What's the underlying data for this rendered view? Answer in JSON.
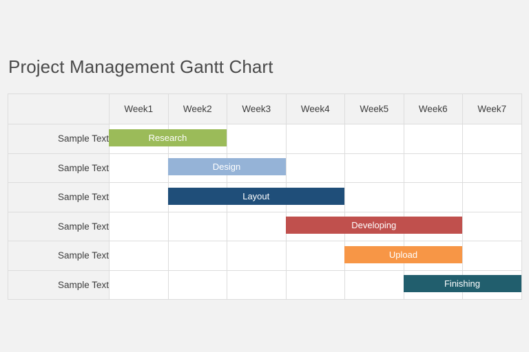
{
  "page": {
    "title": "Project Management Gantt Chart",
    "background_color": "#f2f2f2"
  },
  "table": {
    "corner_label": "",
    "column_headers": [
      "Week1",
      "Week2",
      "Week3",
      "Week4",
      "Week5",
      "Week6",
      "Week7"
    ],
    "row_labels": [
      "Sample Text",
      "Sample Text",
      "Sample Text",
      "Sample Text",
      "Sample Text",
      "Sample Text"
    ],
    "header_background": "#f2f2f2",
    "cell_background": "#ffffff",
    "border_color": "#dcdcdc"
  },
  "chart_data": {
    "type": "bar",
    "title": "Project Management Gantt Chart",
    "xlabel": "",
    "ylabel": "",
    "categories": [
      "Week1",
      "Week2",
      "Week3",
      "Week4",
      "Week5",
      "Week6",
      "Week7"
    ],
    "x": [
      1,
      2,
      3,
      4,
      5,
      6,
      7
    ],
    "xlim": [
      1,
      8
    ],
    "grid": true,
    "legend": "none",
    "orientation": "horizontal",
    "row_labels": [
      "Sample Text",
      "Sample Text",
      "Sample Text",
      "Sample Text",
      "Sample Text",
      "Sample Text"
    ],
    "tasks": [
      {
        "name": "Research",
        "row": 1,
        "row_label": "Sample Text",
        "start_week": 1.0,
        "end_week": 3.0,
        "duration_weeks": 2.0,
        "color": "#9bbb59",
        "label_color": "#ffffff"
      },
      {
        "name": "Design",
        "row": 2,
        "row_label": "Sample Text",
        "start_week": 2.0,
        "end_week": 4.0,
        "duration_weeks": 2.0,
        "color": "#95b3d7",
        "label_color": "#ffffff"
      },
      {
        "name": "Layout",
        "row": 3,
        "row_label": "Sample Text",
        "start_week": 2.0,
        "end_week": 5.0,
        "duration_weeks": 3.0,
        "color": "#1f4e79",
        "label_color": "#ffffff"
      },
      {
        "name": "Developing",
        "row": 4,
        "row_label": "Sample Text",
        "start_week": 4.0,
        "end_week": 7.0,
        "duration_weeks": 3.0,
        "color": "#c0504d",
        "label_color": "#ffffff"
      },
      {
        "name": "Upload",
        "row": 5,
        "row_label": "Sample Text",
        "start_week": 5.0,
        "end_week": 7.0,
        "duration_weeks": 2.0,
        "color": "#f79646",
        "label_color": "#ffffff"
      },
      {
        "name": "Finishing",
        "row": 6,
        "row_label": "Sample Text",
        "start_week": 6.0,
        "end_week": 8.0,
        "duration_weeks": 2.0,
        "color": "#215e6d",
        "label_color": "#ffffff"
      }
    ]
  }
}
